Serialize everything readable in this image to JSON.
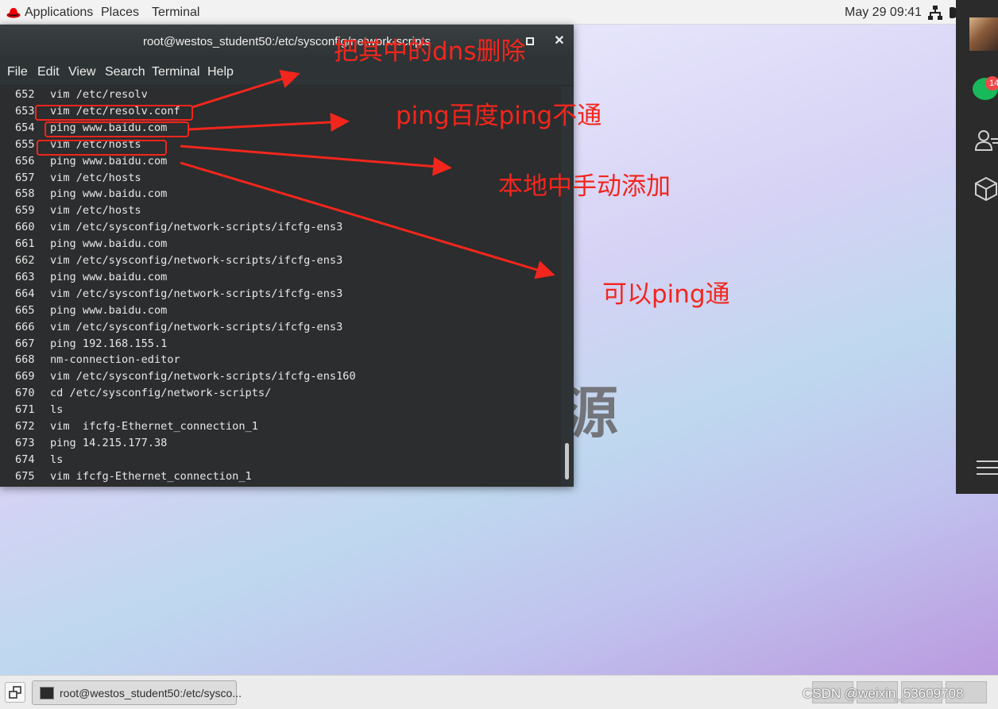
{
  "top_panel": {
    "applications": "Applications",
    "places": "Places",
    "terminal": "Terminal",
    "clock": "May 29 09:41"
  },
  "desktop": {
    "watermark_glyph": "源"
  },
  "side_app": {
    "badge": "14"
  },
  "terminal": {
    "title": "root@westos_student50:/etc/sysconfig/network-scripts",
    "menu": [
      "File",
      "Edit",
      "View",
      "Search",
      "Terminal",
      "Help"
    ],
    "history": [
      {
        "num": "652",
        "cmd": "vim /etc/resolv"
      },
      {
        "num": "653",
        "cmd": "vim /etc/resolv.conf"
      },
      {
        "num": "654",
        "cmd": "ping www.baidu.com"
      },
      {
        "num": "655",
        "cmd": "vim /etc/hosts"
      },
      {
        "num": "656",
        "cmd": "ping www.baidu.com"
      },
      {
        "num": "657",
        "cmd": "vim /etc/hosts"
      },
      {
        "num": "658",
        "cmd": "ping www.baidu.com"
      },
      {
        "num": "659",
        "cmd": "vim /etc/hosts"
      },
      {
        "num": "660",
        "cmd": "vim /etc/sysconfig/network-scripts/ifcfg-ens3"
      },
      {
        "num": "661",
        "cmd": "ping www.baidu.com"
      },
      {
        "num": "662",
        "cmd": "vim /etc/sysconfig/network-scripts/ifcfg-ens3"
      },
      {
        "num": "663",
        "cmd": "ping www.baidu.com"
      },
      {
        "num": "664",
        "cmd": "vim /etc/sysconfig/network-scripts/ifcfg-ens3"
      },
      {
        "num": "665",
        "cmd": "ping www.baidu.com"
      },
      {
        "num": "666",
        "cmd": "vim /etc/sysconfig/network-scripts/ifcfg-ens3"
      },
      {
        "num": "667",
        "cmd": "ping 192.168.155.1"
      },
      {
        "num": "668",
        "cmd": "nm-connection-editor"
      },
      {
        "num": "669",
        "cmd": "vim /etc/sysconfig/network-scripts/ifcfg-ens160"
      },
      {
        "num": "670",
        "cmd": "cd /etc/sysconfig/network-scripts/"
      },
      {
        "num": "671",
        "cmd": "ls"
      },
      {
        "num": "672",
        "cmd": "vim  ifcfg-Ethernet_connection_1"
      },
      {
        "num": "673",
        "cmd": "ping 14.215.177.38"
      },
      {
        "num": "674",
        "cmd": "ls"
      },
      {
        "num": "675",
        "cmd": "vim ifcfg-Ethernet_connection_1"
      }
    ]
  },
  "annotations": {
    "remove_dns": "把其中的dns删除",
    "ping_fail": "ping百度ping不通",
    "add_local": "本地中手动添加",
    "ping_ok": "可以ping通",
    "color": "#f2261d"
  },
  "bottom_panel": {
    "task_label": "root@westos_student50:/etc/sysco...",
    "watermark": "CSDN @weixin_53609708"
  }
}
